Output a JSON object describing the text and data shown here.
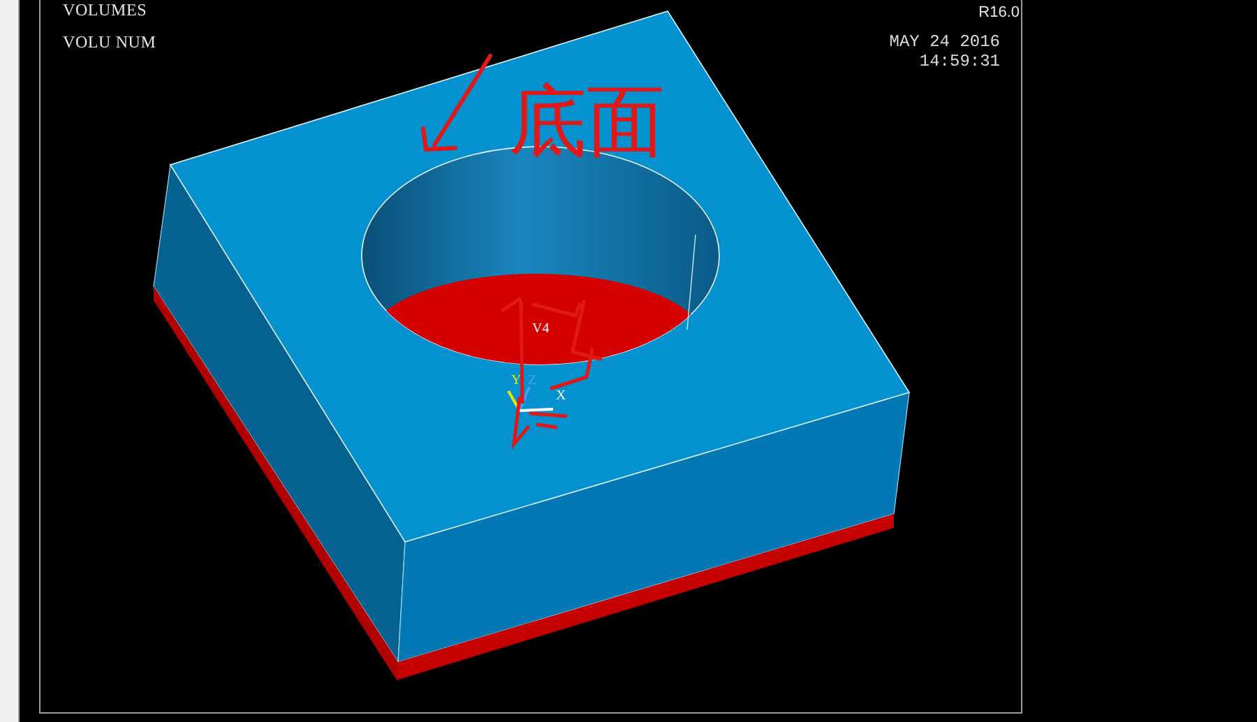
{
  "window": {
    "title_lines": [
      "VOLUMES",
      "VOLU NUM"
    ],
    "version": "R16.0",
    "date": "MAY 24 2016",
    "time": "14:59:31"
  },
  "model": {
    "volume_label": "V4",
    "axes": [
      {
        "label": "Y",
        "color": "#e8e800"
      },
      {
        "label": "Z",
        "color": "#4a9cff"
      },
      {
        "label": "X",
        "color": "#ffffff"
      }
    ]
  },
  "annotations": [
    {
      "kind": "arrow"
    },
    {
      "kind": "text",
      "text": "底面"
    },
    {
      "kind": "scribble"
    }
  ]
}
